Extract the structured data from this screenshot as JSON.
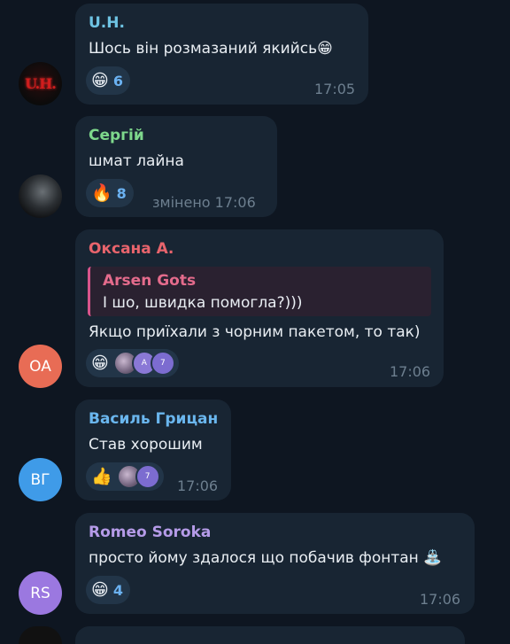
{
  "messages": [
    {
      "author": "U.H.",
      "author_color": "#6ec3e3",
      "avatar_text": "U.H.",
      "text": "Шось він розмазаний якийсь😁",
      "reactions": [
        {
          "emoji": "😁",
          "count": "6"
        }
      ],
      "time": "17:05"
    },
    {
      "author": "Сергій",
      "author_color": "#7ed88c",
      "text": "шмат лайна",
      "reactions": [
        {
          "emoji": "🔥",
          "count": "8"
        }
      ],
      "edited_label": "змінено",
      "time": "17:06"
    },
    {
      "author": "Оксана А.",
      "author_color": "#e8646c",
      "avatar_text": "OA",
      "avatar_color": "#e86c55",
      "reply_to": {
        "author": "Arsen Gots",
        "text": "І шо, швидка помогла?)))"
      },
      "text": "Якщо приїхали з чорним пакетом, то так)",
      "reactions": [
        {
          "emoji": "😁",
          "reactors": [
            "А",
            "7"
          ]
        }
      ],
      "time": "17:06"
    },
    {
      "author": "Василь Грицан",
      "author_color": "#6ab6ee",
      "avatar_text": "ВГ",
      "avatar_color": "#3f9be8",
      "text": "Став хорошим",
      "reactions": [
        {
          "emoji": "👍",
          "reactors": [
            "7"
          ]
        }
      ],
      "time": "17:06"
    },
    {
      "author": "Romeo Soroka",
      "author_color": "#b59be8",
      "avatar_text": "RS",
      "avatar_color": "#9b78e0",
      "text": "просто йому здалося що побачив фонтан ⛲",
      "reactions": [
        {
          "emoji": "😁",
          "count": "4"
        }
      ],
      "time": "17:06"
    }
  ]
}
